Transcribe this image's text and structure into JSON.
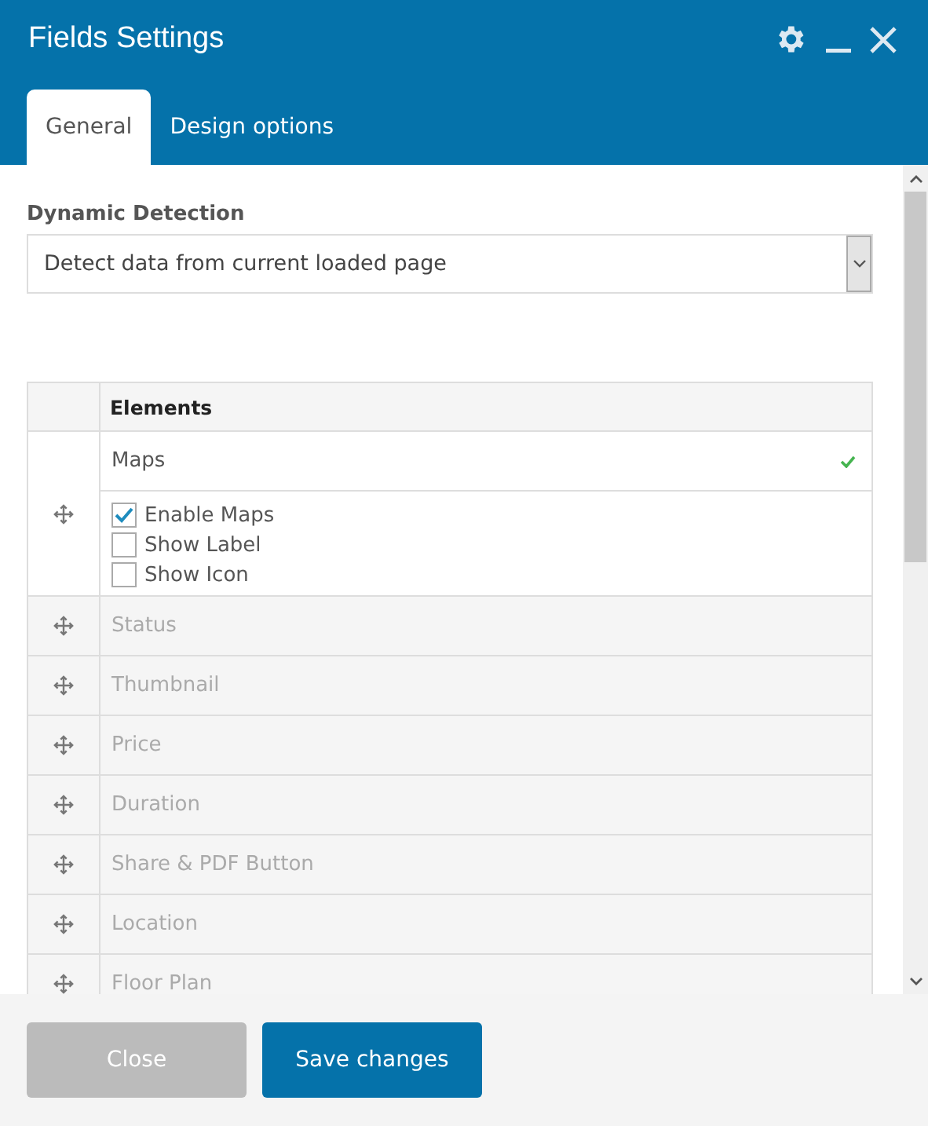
{
  "window": {
    "title": "Fields Settings"
  },
  "tabs": [
    {
      "label": "General",
      "selected": true
    },
    {
      "label": "Design options",
      "selected": false
    }
  ],
  "dynamic_detection": {
    "label": "Dynamic Detection",
    "value": "Detect data from current loaded page"
  },
  "table": {
    "column_header": "Elements",
    "rows": [
      {
        "label": "Maps",
        "enabled": true,
        "expanded": true,
        "options": [
          {
            "label": "Enable Maps",
            "checked": true
          },
          {
            "label": "Show Label",
            "checked": false
          },
          {
            "label": "Show Icon",
            "checked": false
          }
        ]
      },
      {
        "label": "Status",
        "enabled": false,
        "expanded": false
      },
      {
        "label": "Thumbnail",
        "enabled": false,
        "expanded": false
      },
      {
        "label": "Price",
        "enabled": false,
        "expanded": false
      },
      {
        "label": "Duration",
        "enabled": false,
        "expanded": false
      },
      {
        "label": "Share & PDF Button",
        "enabled": false,
        "expanded": false
      },
      {
        "label": "Location",
        "enabled": false,
        "expanded": false
      },
      {
        "label": "Floor Plan",
        "enabled": false,
        "expanded": false
      }
    ]
  },
  "buttons": [
    {
      "label": "Close",
      "kind": "secondary"
    },
    {
      "label": "Save changes",
      "kind": "primary"
    }
  ]
}
